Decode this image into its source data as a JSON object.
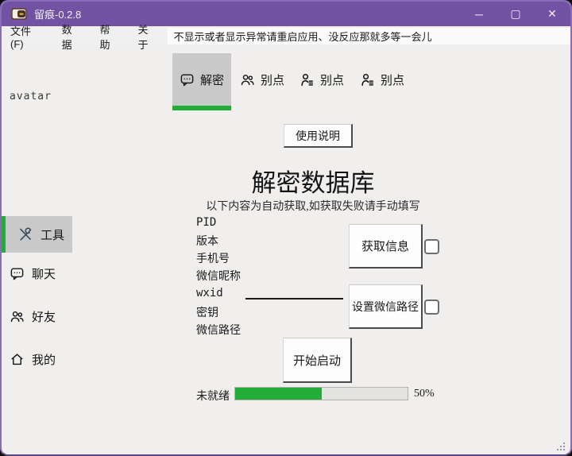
{
  "window": {
    "title": "留痕-0.2.8",
    "controls": {
      "minimize": "─",
      "maximize": "▢",
      "close": "✕"
    }
  },
  "menu": {
    "items": [
      {
        "label": "文件(F)"
      },
      {
        "label": "数据"
      },
      {
        "label": "帮助"
      },
      {
        "label": "关于"
      }
    ],
    "notice": "不显示或者显示异常请重启应用、没反应那就多等一会儿"
  },
  "sidebar": {
    "avatar_placeholder": "avatar",
    "items": [
      {
        "label": "工具",
        "icon": "tools-icon",
        "selected": true
      },
      {
        "label": "聊天",
        "icon": "chat-icon",
        "selected": false
      },
      {
        "label": "好友",
        "icon": "friends-icon",
        "selected": false
      },
      {
        "label": "我的",
        "icon": "home-icon",
        "selected": false
      }
    ]
  },
  "tabs": [
    {
      "label": "解密",
      "icon": "chat-bubble-icon",
      "selected": true
    },
    {
      "label": "别点",
      "icon": "people-icon",
      "selected": false
    },
    {
      "label": "别点",
      "icon": "person-list-icon",
      "selected": false
    },
    {
      "label": "别点",
      "icon": "person-list-icon",
      "selected": false
    }
  ],
  "main": {
    "help_button": "使用说明",
    "title": "解密数据库",
    "subtitle": "以下内容为自动获取,如获取失败请手动填写",
    "fields": [
      {
        "label": "PID",
        "value": ""
      },
      {
        "label": "版本",
        "value": ""
      },
      {
        "label": "手机号",
        "value": ""
      },
      {
        "label": "微信昵称",
        "value": ""
      },
      {
        "label": "wxid",
        "value": ""
      },
      {
        "label": "密钥",
        "value": ""
      },
      {
        "label": "微信路径",
        "value": ""
      }
    ],
    "get_info_button": "获取信息",
    "set_path_button": "设置微信路径",
    "start_button": "开始启动",
    "progress": {
      "status": "未就绪",
      "percent": 50,
      "percent_label": "50%"
    }
  },
  "colors": {
    "titlebar": "#7252a3",
    "accent_green": "#22ac38",
    "selected_gray": "#c9c9c9",
    "content_bg": "#f0efed",
    "menu_bg": "#f0f0f0"
  }
}
